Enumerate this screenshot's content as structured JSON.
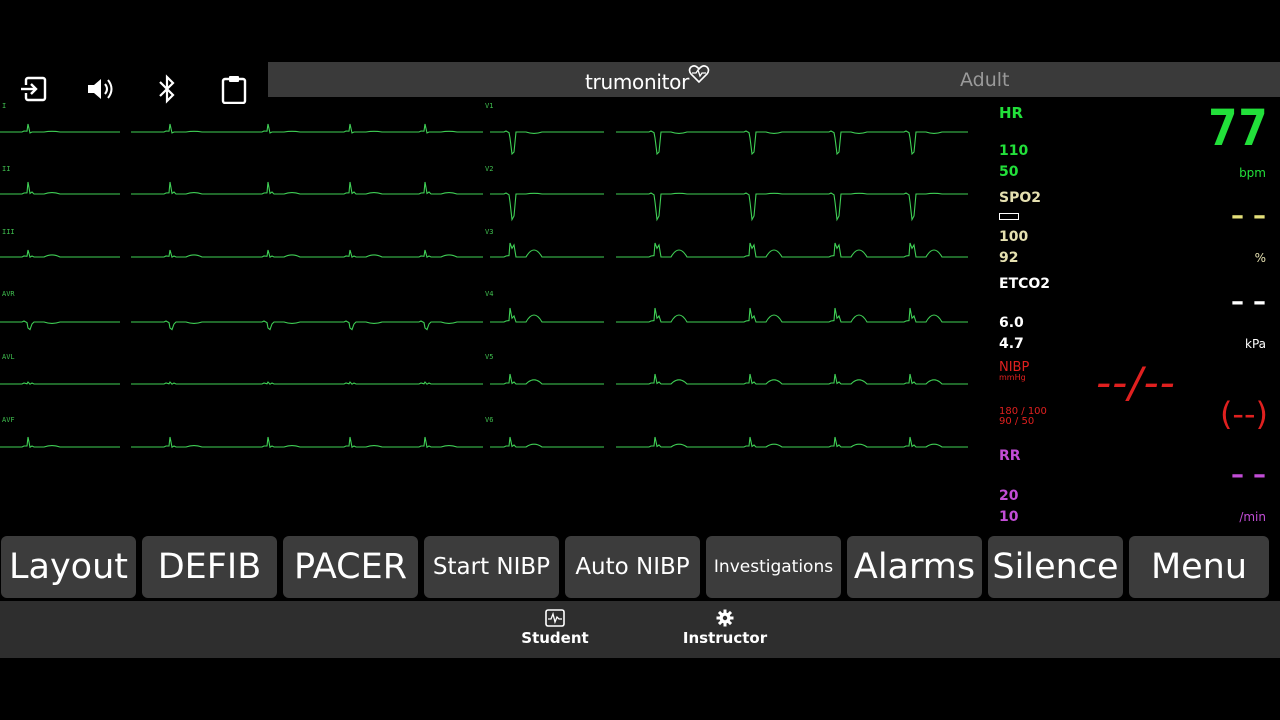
{
  "header": {
    "brand": "trumonitor",
    "patient_type": "Adult"
  },
  "toolbar": {
    "icons": [
      "exit-icon",
      "volume-icon",
      "bluetooth-icon",
      "clipboard-icon"
    ]
  },
  "ecg": {
    "leads": [
      "I",
      "II",
      "III",
      "AVR",
      "AVL",
      "AVF",
      "V1",
      "V2",
      "V3",
      "V4",
      "V5",
      "V6"
    ],
    "color": "#3fcf55"
  },
  "vitals": {
    "hr": {
      "label": "HR",
      "high": "110",
      "low": "50",
      "value": "77",
      "unit": "bpm",
      "color": "#22e03a"
    },
    "spo2": {
      "label": "SPO2",
      "high": "100",
      "low": "92",
      "value": "– –",
      "unit": "%",
      "color": "#e5e07a"
    },
    "etco2": {
      "label": "ETCO2",
      "high": "6.0",
      "low": "4.7",
      "value": "– –",
      "unit": "kPa",
      "color": "#ffffff"
    },
    "nibp": {
      "label": "NIBP",
      "unit": "mmHg",
      "sys_limits": "180 / 100",
      "dia_limits": "90 / 50",
      "value": "--/--",
      "mean": "(--)",
      "color": "#e0201f"
    },
    "rr": {
      "label": "RR",
      "high": "20",
      "low": "10",
      "value": "– –",
      "unit": "/min",
      "color": "#c24dd6"
    }
  },
  "buttons": [
    "Layout",
    "DEFIB",
    "PACER",
    "Start NIBP",
    "Auto NIBP",
    "Investigations",
    "Alarms",
    "Silence",
    "Menu"
  ],
  "footer": {
    "modes": [
      {
        "label": "Student",
        "icon": "waveform-icon"
      },
      {
        "label": "Instructor",
        "icon": "gear-icon"
      }
    ]
  }
}
